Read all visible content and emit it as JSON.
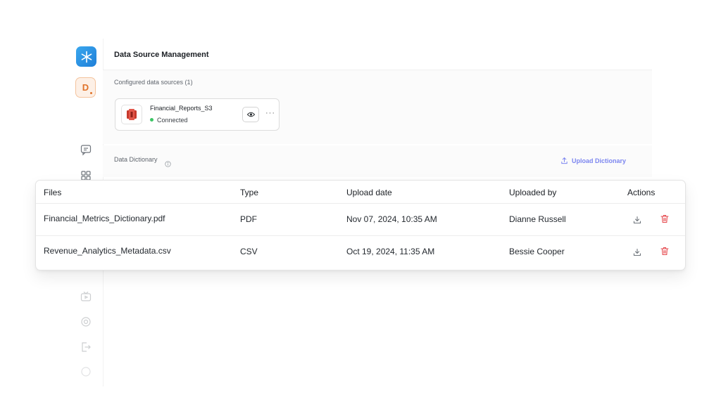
{
  "header": {
    "title": "Data Source Management"
  },
  "sidebar": {
    "avatar_initial": "D"
  },
  "configured": {
    "label": "Configured data sources (1)",
    "sources": [
      {
        "name": "Financial_Reports_S3",
        "status": "Connected",
        "status_color": "#3cc565"
      }
    ]
  },
  "dictionary": {
    "label": "Data Dictionary",
    "upload_label": "Upload Dictionary"
  },
  "table": {
    "columns": [
      "Files",
      "Type",
      "Upload date",
      "Uploaded by",
      "Actions"
    ],
    "rows": [
      {
        "file": "Financial_Metrics_Dictionary.pdf",
        "type": "PDF",
        "date": "Nov 07, 2024, 10:35 AM",
        "by": "Dianne Russell"
      },
      {
        "file": "Revenue_Analytics_Metadata.csv",
        "type": "CSV",
        "date": "Oct 19, 2024, 11:35 AM",
        "by": "Bessie Cooper"
      }
    ]
  },
  "colors": {
    "accent": "#7c86f0",
    "danger": "#e5484d",
    "logo": "#1f7fd8",
    "avatar": "#e0732a"
  }
}
